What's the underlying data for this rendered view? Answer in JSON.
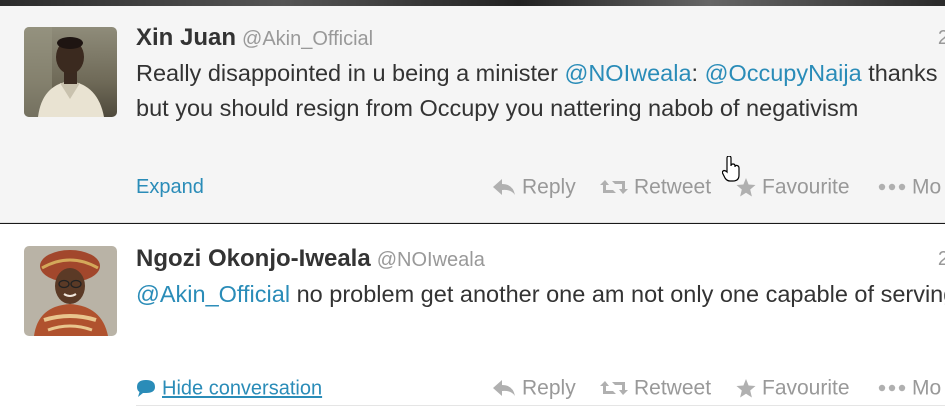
{
  "tweets": [
    {
      "fullname": "Xin Juan",
      "username": "@Akin_Official",
      "time": "2",
      "text_parts": [
        "Really disappointed in u being a minister ",
        "@NOIweala",
        ": ",
        "@OccupyNaija",
        " thanks but you should resign from Occupy you nattering nabob of negativism"
      ],
      "link_label": "Expand",
      "avatar_icon": "user-photo-icon"
    },
    {
      "fullname": "Ngozi Okonjo-Iweala",
      "username": "@NOIweala",
      "time": "2",
      "text_parts": [
        "@Akin_Official",
        " no problem get another one am not only one capable of serving"
      ],
      "link_label": "Hide conversation",
      "avatar_icon": "user-photo-icon"
    }
  ],
  "actions": {
    "reply": "Reply",
    "retweet": "Retweet",
    "favourite": "Favourite",
    "more": "Mo"
  },
  "colors": {
    "link": "#2a8cb8",
    "text": "#333333",
    "muted": "#999999",
    "expanded_bg": "#f5f5f5"
  }
}
